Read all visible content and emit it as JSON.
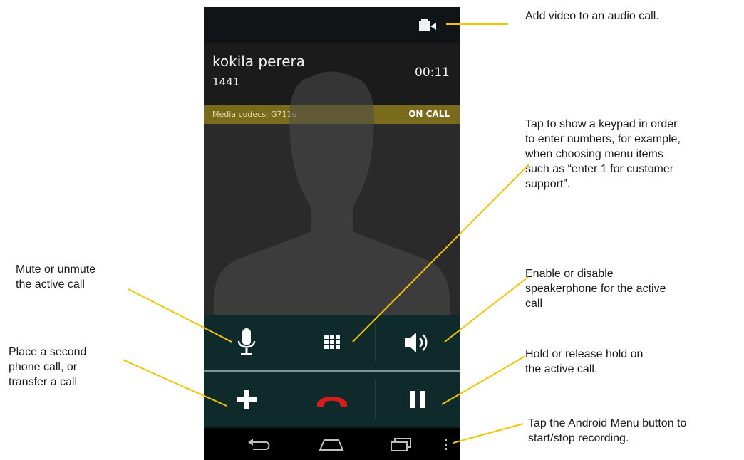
{
  "call": {
    "caller_name": "kokila perera",
    "caller_number": "1441",
    "timer": "00:11",
    "codecs": "Media codecs: G711u",
    "state": "ON CALL"
  },
  "controls": {
    "row1": [
      "mic-icon",
      "dialpad-icon",
      "speaker-icon"
    ],
    "row2": [
      "add-call-icon",
      "end-call-icon",
      "pause-icon"
    ]
  },
  "navbar": [
    "back-icon",
    "home-icon",
    "recents-icon",
    "menu-icon"
  ],
  "colors": {
    "accent_yellow": "#f5c400",
    "status_bar": "#7a6a1c",
    "end_call_red": "#d81b1b",
    "controls_bg": "#0f2a2a"
  },
  "annotations": {
    "video": [
      "Add video to an audio call."
    ],
    "keypad": [
      "Tap to show a keypad in order",
      "to enter numbers, for example,",
      "when choosing menu items",
      "such as “enter 1 for customer",
      "support”."
    ],
    "mute": [
      "Mute or unmute",
      "the active call"
    ],
    "speaker": [
      "Enable or disable",
      "speakerphone for the active",
      "call"
    ],
    "add_call": [
      "Place a second",
      "phone call, or",
      "transfer a call"
    ],
    "hold": [
      "Hold or release hold on",
      "the active call."
    ],
    "menu": [
      "Tap the Android Menu button to",
      "start/stop recording."
    ]
  }
}
